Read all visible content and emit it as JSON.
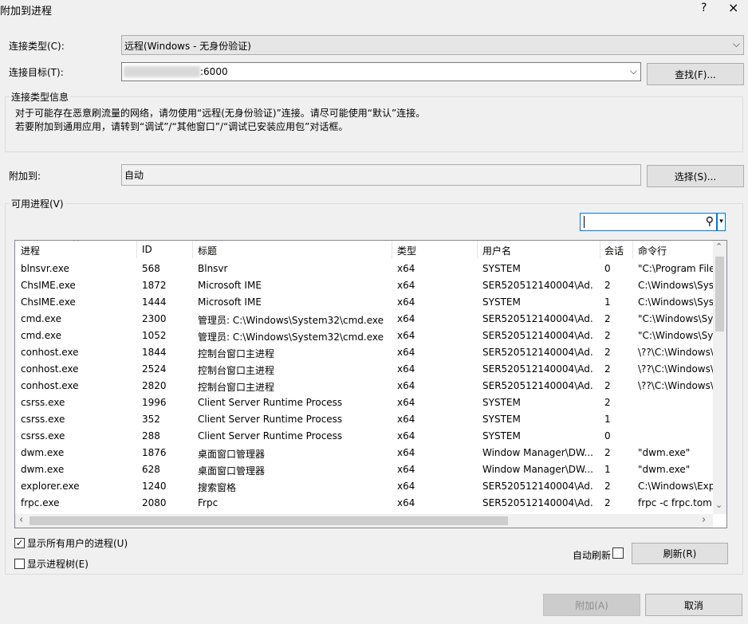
{
  "window": {
    "title": "附加到进程",
    "help_label": "?",
    "close_label": "×"
  },
  "connection_type": {
    "label": "连接类型(C):",
    "value": "远程(Windows - 无身份验证)"
  },
  "connection_target": {
    "label": "连接目标(T):",
    "value": ":6000",
    "find_button": "查找(F)..."
  },
  "info_group": {
    "title": "连接类型信息",
    "line1": "对于可能存在恶意刷流量的网络，请勿使用“远程(无身份验证)”连接。请尽可能使用“默认”连接。",
    "line2": "若要附加到通用应用，请转到“调试”/“其他窗口”/“调试已安装应用包”对话框。"
  },
  "attach_to": {
    "label": "附加到:",
    "value": "自动",
    "select_button": "选择(S)..."
  },
  "processes_group": {
    "title": "可用进程(V)",
    "search_value": ""
  },
  "table": {
    "columns": [
      "进程",
      "ID",
      "标题",
      "类型",
      "用户名",
      "会话",
      "命令行"
    ],
    "rows": [
      [
        "blnsvr.exe",
        "568",
        "Blnsvr",
        "x64",
        "SYSTEM",
        "0",
        "\"C:\\Program File"
      ],
      [
        "ChsIME.exe",
        "1872",
        "Microsoft IME",
        "x64",
        "SER520512140004\\Ad...",
        "2",
        "C:\\Windows\\Sys"
      ],
      [
        "ChsIME.exe",
        "1444",
        "Microsoft IME",
        "x64",
        "SYSTEM",
        "1",
        "C:\\Windows\\Sys"
      ],
      [
        "cmd.exe",
        "2300",
        "管理员: C:\\Windows\\System32\\cmd.exe ...",
        "x64",
        "SER520512140004\\Ad...",
        "2",
        "\"C:\\Windows\\Sy"
      ],
      [
        "cmd.exe",
        "1052",
        "管理员: C:\\Windows\\System32\\cmd.exe ...",
        "x64",
        "SER520512140004\\Ad...",
        "2",
        "\"C:\\Windows\\Sy"
      ],
      [
        "conhost.exe",
        "1844",
        "控制台窗口主进程",
        "x64",
        "SER520512140004\\Ad...",
        "2",
        "\\??\\C:\\Windows\\"
      ],
      [
        "conhost.exe",
        "2524",
        "控制台窗口主进程",
        "x64",
        "SER520512140004\\Ad...",
        "2",
        "\\??\\C:\\Windows\\"
      ],
      [
        "conhost.exe",
        "2820",
        "控制台窗口主进程",
        "x64",
        "SER520512140004\\Ad...",
        "2",
        "\\??\\C:\\Windows\\"
      ],
      [
        "csrss.exe",
        "1996",
        "Client Server Runtime Process",
        "x64",
        "SYSTEM",
        "2",
        ""
      ],
      [
        "csrss.exe",
        "352",
        "Client Server Runtime Process",
        "x64",
        "SYSTEM",
        "1",
        ""
      ],
      [
        "csrss.exe",
        "288",
        "Client Server Runtime Process",
        "x64",
        "SYSTEM",
        "0",
        ""
      ],
      [
        "dwm.exe",
        "1876",
        "桌面窗口管理器",
        "x64",
        "Window Manager\\DW...",
        "2",
        "\"dwm.exe\""
      ],
      [
        "dwm.exe",
        "628",
        "桌面窗口管理器",
        "x64",
        "Window Manager\\DW...",
        "1",
        "\"dwm.exe\""
      ],
      [
        "explorer.exe",
        "1240",
        "搜索窗格",
        "x64",
        "SER520512140004\\Ad...",
        "2",
        "C:\\Windows\\Exp"
      ],
      [
        "frpc.exe",
        "2080",
        "Frpc",
        "x64",
        "SER520512140004\\Ad...",
        "2",
        "frpc  -c frpc.tom"
      ]
    ]
  },
  "options": {
    "show_all_users": {
      "label": "显示所有用户的进程(U)",
      "checked": true
    },
    "show_tree": {
      "label": "显示进程树(E)",
      "checked": false
    },
    "auto_refresh": {
      "label": "自动刷新",
      "checked": false
    },
    "refresh_button": "刷新(R)"
  },
  "footer": {
    "attach_button": "附加(A)",
    "cancel_button": "取消"
  },
  "glyphs": {
    "check": "✓",
    "dropdown_arrow": "⌵",
    "sort_up": "^",
    "search": "⚲",
    "scroll_up": "⌃",
    "scroll_down": "⌄",
    "scroll_left": "‹",
    "scroll_right": "›",
    "small_down": "▾"
  }
}
